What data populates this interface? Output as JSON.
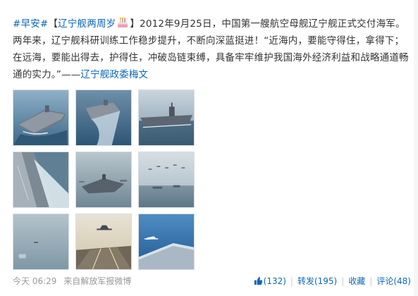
{
  "post": {
    "topic_1": "#早安#",
    "open_bracket": "【",
    "topic_2_text": "辽宁舰两周岁",
    "close_bracket": "】",
    "body_text": "2012年9月25日，中国第一艘航空母舰辽宁舰正式交付海军。两年来，辽宁舰科研训练工作稳步提升，不断向深蓝挺进！“近海内，要能守得住，拿得下；在远海，要能出得去，护得住，冲破岛链束缚，具备牢牢维护我国海外经济利益和战略通道畅通的实力。”——",
    "author_link": "辽宁舰政委梅文",
    "cake_icon": "birthday-cake-icon"
  },
  "images": [
    {
      "name": "carrier-bow-view",
      "scene": "carrier-sea"
    },
    {
      "name": "carrier-aerial-wake",
      "scene": "carrier-wake"
    },
    {
      "name": "carrier-side-view",
      "scene": "carrier-side"
    },
    {
      "name": "carrier-deck-spray",
      "scene": "deck-spray"
    },
    {
      "name": "carrier-fleet-haze",
      "scene": "fleet-haze"
    },
    {
      "name": "aircraft-formation",
      "scene": "formation"
    },
    {
      "name": "open-sea-haze",
      "scene": "sea-haze"
    },
    {
      "name": "jet-takeoff-deck",
      "scene": "jet-deck"
    },
    {
      "name": "jet-approach-blue-sea",
      "scene": "jet-blue"
    }
  ],
  "footer": {
    "time": "今天 06:29",
    "source_prefix": "来自",
    "source": "解放军报微博",
    "like_count": "(132)",
    "repost_label": "转发(195)",
    "favorite_label": "收藏",
    "comment_label": "评论(48)",
    "separator": "|"
  }
}
